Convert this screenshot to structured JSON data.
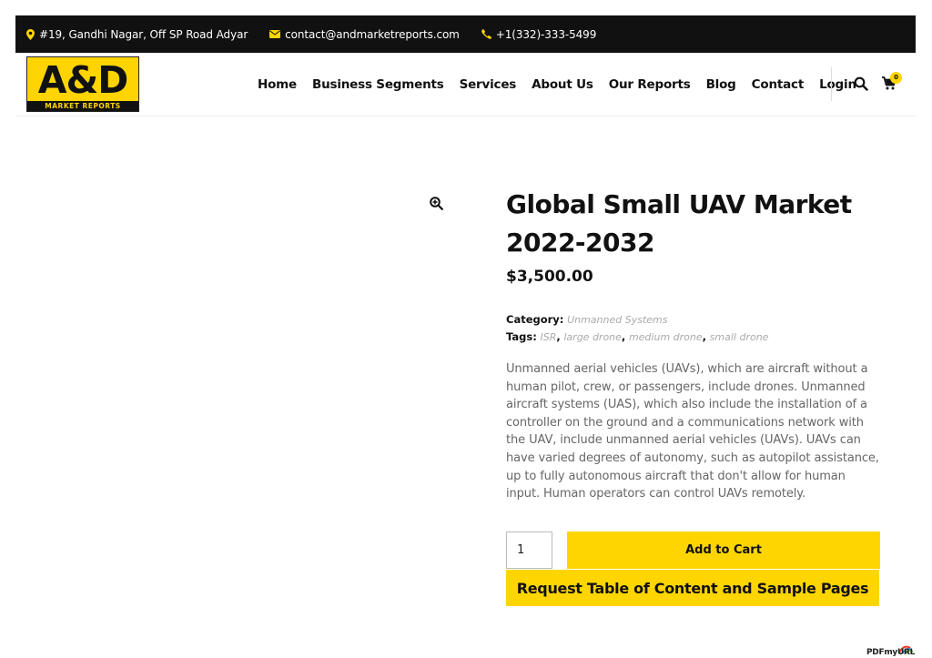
{
  "topbar": {
    "address": "#19, Gandhi Nagar, Off SP Road Adyar",
    "email": "contact@andmarketreports.com",
    "phone": "+1(332)-333-5499"
  },
  "logo": {
    "mark": "A&D",
    "tagline": "MARKET REPORTS"
  },
  "nav": {
    "items": [
      "Home",
      "Business Segments",
      "Services",
      "About Us",
      "Our Reports",
      "Blog",
      "Contact",
      "Login"
    ]
  },
  "cart": {
    "count": "0"
  },
  "product": {
    "title": "Global Small UAV Market 2022-2032",
    "price": "$3,500.00",
    "category_label": "Category:",
    "category": "Unmanned Systems",
    "tags_label": "Tags:",
    "tags": [
      "ISR",
      "large drone",
      "medium drone",
      "small drone"
    ],
    "description": "Unmanned aerial vehicles (UAVs), which are aircraft without a human pilot, crew, or passengers, include drones. Unmanned aircraft systems (UAS), which also include the installation of a controller on the ground and a communications network with the UAV, include unmanned aerial vehicles (UAVs). UAVs can have varied degrees of autonomy, such as autopilot assistance, up to fully autonomous aircraft that don't allow for human input. Human operators can control UAVs remotely.",
    "quantity": "1",
    "add_to_cart": "Add to Cart",
    "request_label": "Request Table of Content and Sample Pages"
  },
  "watermark": "PDFmyURL",
  "colors": {
    "accent": "#ffd500",
    "topbar": "#111111"
  }
}
